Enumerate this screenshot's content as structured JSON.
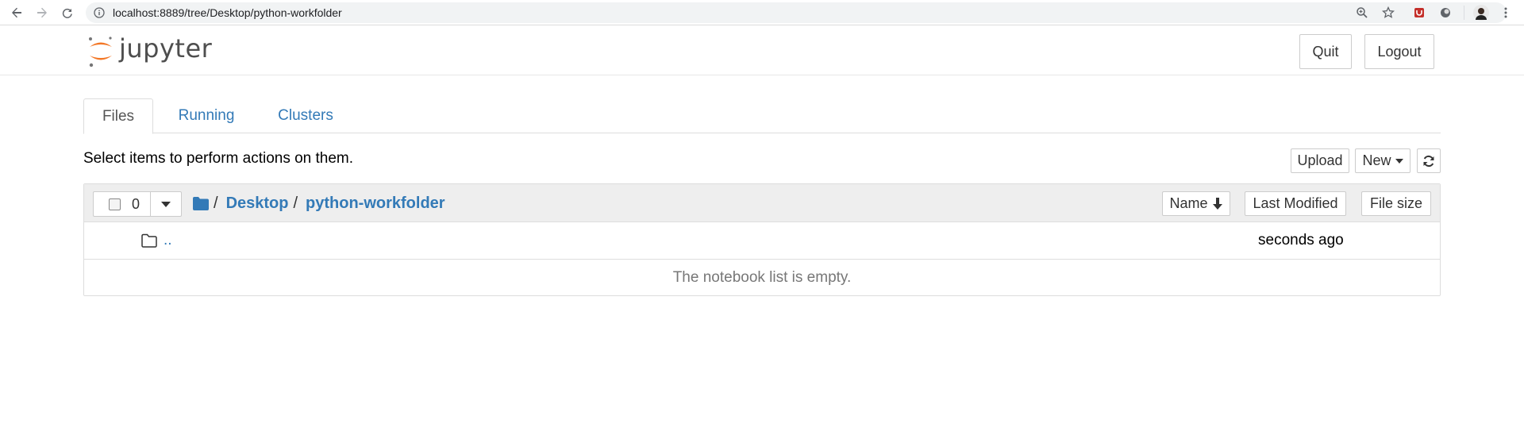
{
  "browser": {
    "url": "localhost:8889/tree/Desktop/python-workfolder",
    "icons": [
      "back-arrow-icon",
      "forward-arrow-icon",
      "reload-icon",
      "info-icon",
      "zoom-icon",
      "star-icon",
      "extension-icon",
      "extension-circle-icon",
      "profile-avatar",
      "menu-dots-icon"
    ]
  },
  "header": {
    "logo_text": "jupyter",
    "quit_label": "Quit",
    "logout_label": "Logout"
  },
  "tabs": [
    {
      "label": "Files",
      "active": true
    },
    {
      "label": "Running",
      "active": false
    },
    {
      "label": "Clusters",
      "active": false
    }
  ],
  "toolbar": {
    "hint": "Select items to perform actions on them.",
    "upload_label": "Upload",
    "new_label": "New",
    "refresh_icon": "refresh-icon"
  },
  "file_list": {
    "selected_count": "0",
    "breadcrumb": {
      "root_sep": "/",
      "items": [
        {
          "label": "Desktop",
          "sep": "/"
        },
        {
          "label": "python-workfolder"
        }
      ]
    },
    "sort": {
      "name_label": "Name",
      "last_modified_label": "Last Modified",
      "file_size_label": "File size"
    },
    "parent_row": {
      "name": "..",
      "modified": "seconds ago"
    },
    "empty_message": "The notebook list is empty."
  },
  "colors": {
    "link": "#337ab7",
    "jupyter_orange": "#f37726",
    "logo_text": "#4e4e4e",
    "list_header_bg": "#eeeeee"
  }
}
